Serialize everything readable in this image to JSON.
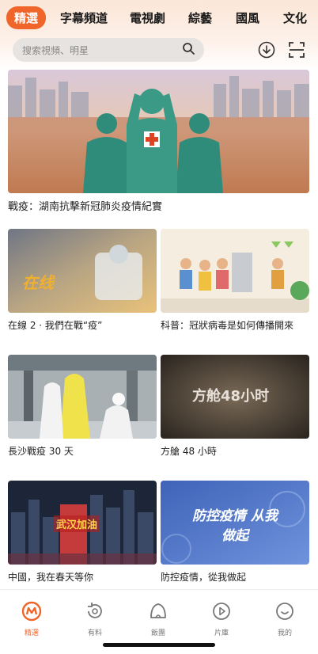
{
  "tabs": [
    "精選",
    "字幕頻道",
    "電視劇",
    "綜藝",
    "國風",
    "文化"
  ],
  "search": {
    "placeholder": "搜索視頻、明星"
  },
  "hero": {
    "title": "戰疫：湖南抗擊新冠肺炎疫情紀實"
  },
  "videos": [
    {
      "title": "在線 2 · 我們在戰“疫”",
      "caption": "在线"
    },
    {
      "title": "科普：冠狀病毒是如何傳播開來",
      "caption": ""
    },
    {
      "title": "長沙戰疫 30 天",
      "caption": ""
    },
    {
      "title": "方艙 48 小時",
      "caption": "方舱48小时"
    },
    {
      "title": "中國，我在春天等你",
      "caption": "武汉加油"
    },
    {
      "title": "防控疫情，從我做起",
      "caption": "防控疫情 从我做起"
    }
  ],
  "bottom_nav": [
    {
      "label": "精選",
      "icon": "featured-icon",
      "active": true
    },
    {
      "label": "有料",
      "icon": "refresh-icon",
      "active": false
    },
    {
      "label": "飯團",
      "icon": "riceball-icon",
      "active": false
    },
    {
      "label": "片庫",
      "icon": "play-icon",
      "active": false
    },
    {
      "label": "我的",
      "icon": "smile-icon",
      "active": false
    }
  ],
  "colors": {
    "accent": "#f0662a"
  }
}
